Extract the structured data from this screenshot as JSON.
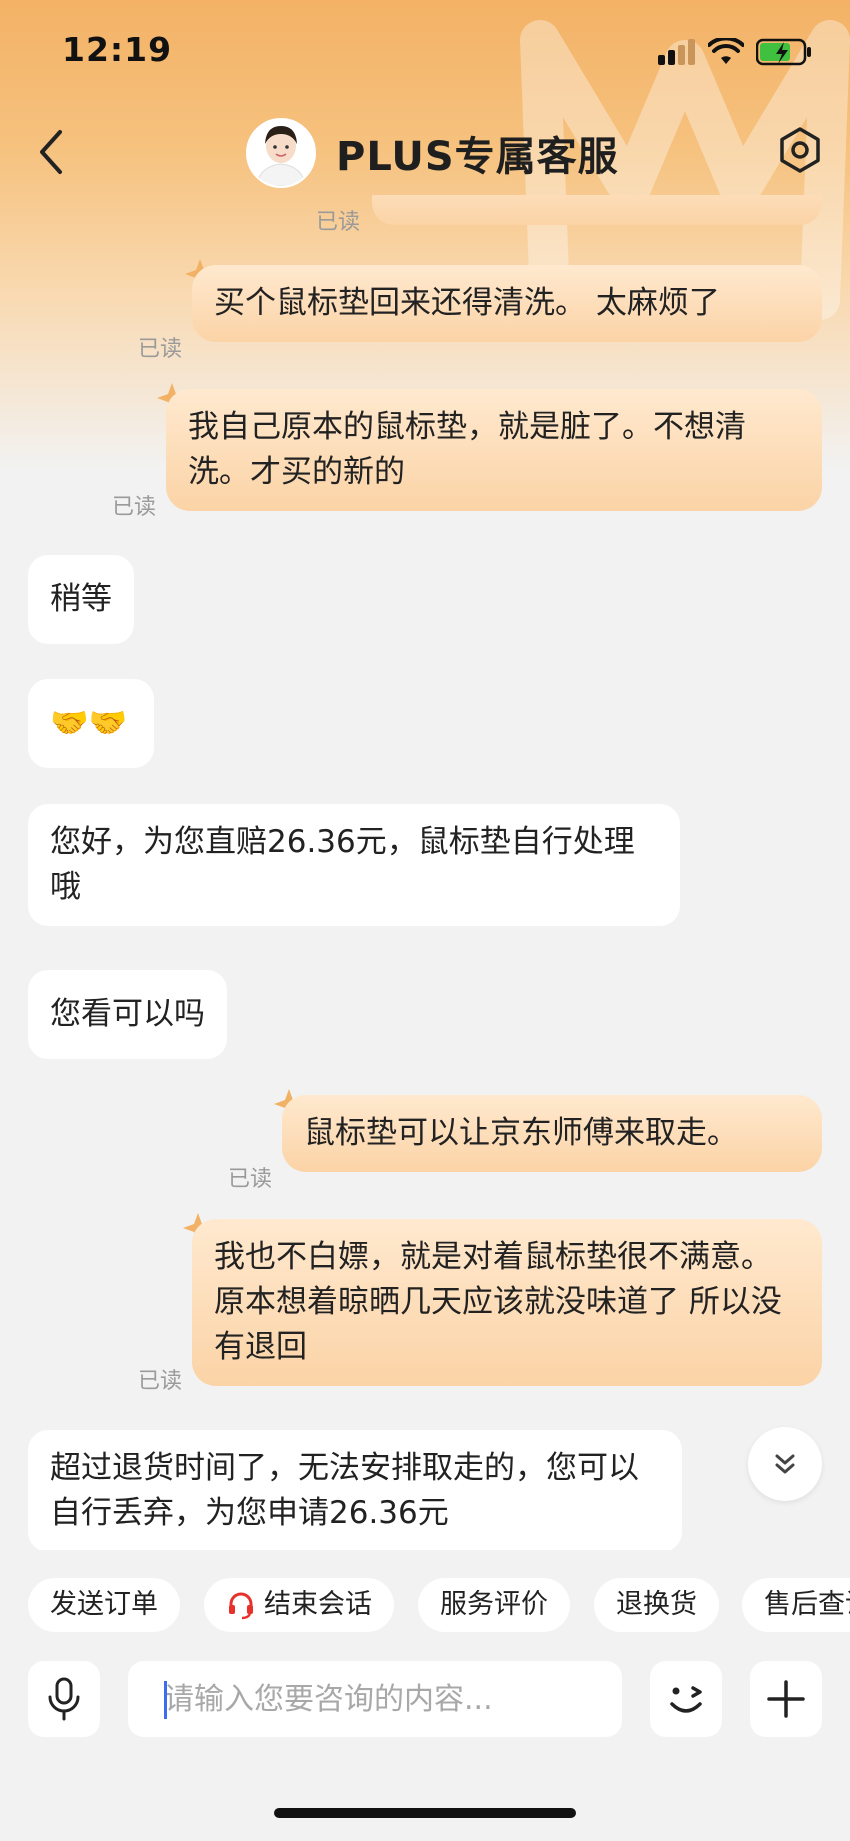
{
  "status_bar": {
    "time": "12:19"
  },
  "header": {
    "title": "PLUS专属客服"
  },
  "messages": [
    {
      "side": "out",
      "text": "",
      "read": "已读"
    },
    {
      "side": "out",
      "text": "买个鼠标垫回来还得清洗。 太麻烦了",
      "read": "已读"
    },
    {
      "side": "out",
      "text": "我自己原本的鼠标垫，就是脏了。不想清洗。才买的新的",
      "read": "已读"
    },
    {
      "side": "in",
      "text": "稍等"
    },
    {
      "side": "in",
      "text": "🤝🤝"
    },
    {
      "side": "in",
      "text": "您好，为您直赔26.36元，鼠标垫自行处理哦"
    },
    {
      "side": "in",
      "text": "您看可以吗"
    },
    {
      "side": "out",
      "text": "鼠标垫可以让京东师傅来取走。",
      "read": "已读"
    },
    {
      "side": "out",
      "text": "我也不白嫖，就是对着鼠标垫很不满意。 原本想着晾晒几天应该就没味道了 所以没有退回",
      "read": "已读"
    },
    {
      "side": "in",
      "text": "超过退货时间了，无法安排取走的，您可以自行丢弃，为您申请26.36元"
    }
  ],
  "quick_actions": [
    {
      "label": "发送订单"
    },
    {
      "label": "结束会话",
      "icon": "headset-icon"
    },
    {
      "label": "服务评价"
    },
    {
      "label": "退换货"
    },
    {
      "label": "售后查询"
    }
  ],
  "input": {
    "placeholder": "请输入您要咨询的内容..."
  },
  "colors": {
    "accent": "#f3b266",
    "out_bubble": "#fbd3a6",
    "headset": "#e8312a"
  }
}
